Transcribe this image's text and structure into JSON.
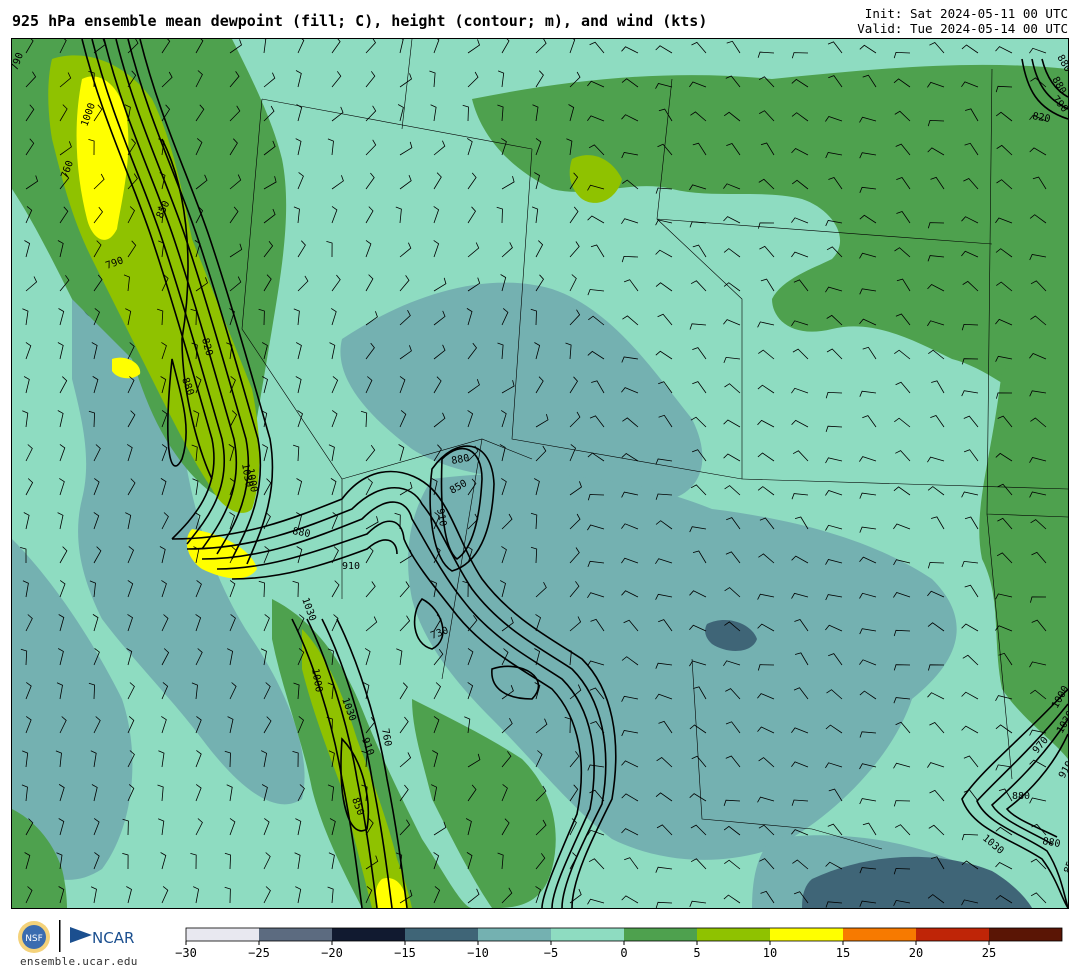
{
  "header": {
    "title": "925 hPa ensemble mean dewpoint (fill; C), height (contour; m), and wind (kts)",
    "init": "Init: Sat 2024-05-11 00 UTC",
    "valid": "Valid: Tue 2024-05-14 00 UTC"
  },
  "footer": {
    "logo_nsf": "NSF",
    "logo_ncar": "NCAR",
    "website": "ensemble.ucar.edu"
  },
  "colorbar": {
    "ticks": [
      "−30",
      "−25",
      "−20",
      "−15",
      "−10",
      "−5",
      "0",
      "5",
      "10",
      "15",
      "20",
      "25"
    ],
    "colors": [
      "#e8e8f0",
      "#5c6b80",
      "#111a30",
      "#3f6577",
      "#74b1b1",
      "#8edcc1",
      "#4ea14e",
      "#8fc200",
      "#ffff00",
      "#f77a00",
      "#bf2507",
      "#5a1505"
    ]
  },
  "map": {
    "colors": {
      "background": "#8edcc1",
      "dry": "#74b1b1",
      "very_dry": "#3f6577",
      "moist": "#4ea14e",
      "moist2": "#8fc200",
      "wet": "#ffff00"
    },
    "contour_labels": [
      "790",
      "1000",
      "760",
      "850",
      "1030",
      "880",
      "910",
      "730",
      "880",
      "850",
      "910",
      "790",
      "880",
      "820",
      "1000",
      "1030",
      "1000",
      "1030",
      "850",
      "910",
      "880",
      "1030",
      "880",
      "820",
      "880",
      "790",
      "760",
      "1000",
      "970",
      "1030",
      "910",
      "850",
      "880"
    ]
  }
}
